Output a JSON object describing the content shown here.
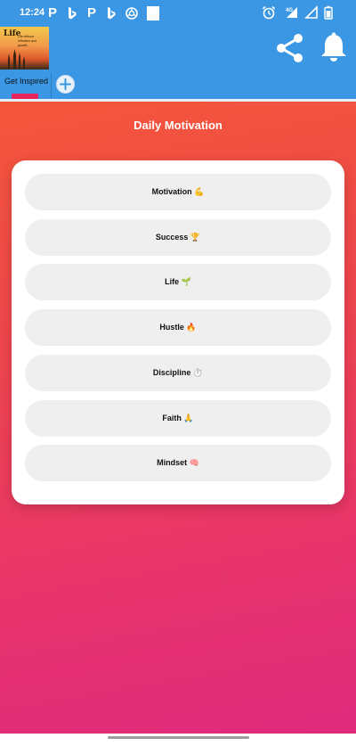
{
  "status_bar": {
    "time": "12:24",
    "left_icons": [
      "p-icon",
      "bing-icon",
      "p-icon",
      "bing-icon",
      "openai-icon",
      "square-notification-icon"
    ],
    "network_label": "4G"
  },
  "app_bar": {
    "thumbnail": {
      "title": "Life",
      "subtitle": "Life without reflection and growth..."
    },
    "tab_label": "Get Inspired"
  },
  "main": {
    "title": "Daily Motivation",
    "categories": [
      {
        "label": "Motivation 💪"
      },
      {
        "label": "Success 🏆"
      },
      {
        "label": "Life 🌱"
      },
      {
        "label": "Hustle 🔥"
      },
      {
        "label": "Discipline ⏱️"
      },
      {
        "label": "Faith 🙏"
      },
      {
        "label": "Mindset 🧠"
      }
    ]
  },
  "colors": {
    "app_bar": "#3b97e4",
    "tab_indicator": "#e8245e",
    "gradient_top": "#f4563a",
    "gradient_bottom": "#df2a7c",
    "button_bg": "#efefef"
  }
}
